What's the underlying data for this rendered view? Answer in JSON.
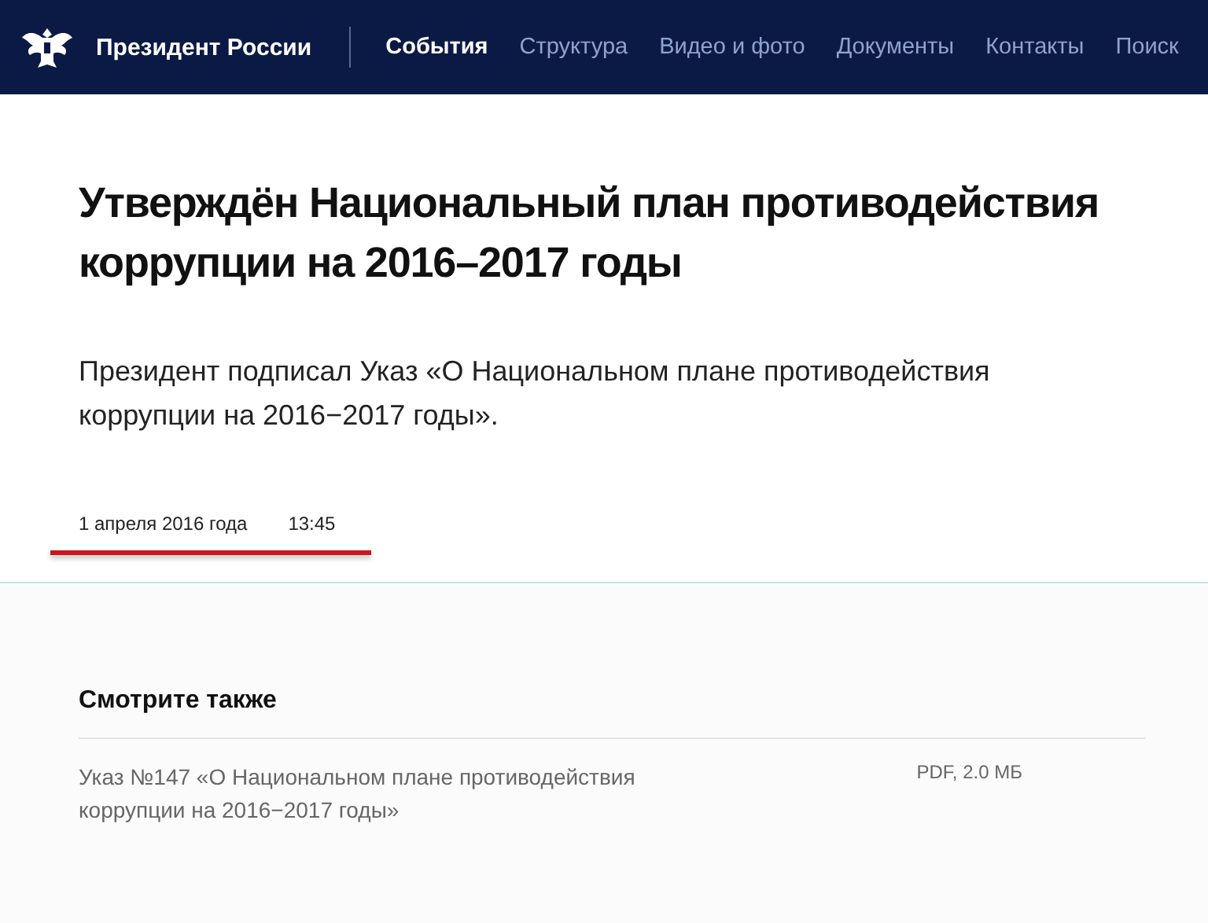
{
  "header": {
    "site_title": "Президент России",
    "nav": [
      {
        "label": "События",
        "selected": true
      },
      {
        "label": "Структура",
        "selected": false
      },
      {
        "label": "Видео и фото",
        "selected": false
      },
      {
        "label": "Документы",
        "selected": false
      },
      {
        "label": "Контакты",
        "selected": false
      },
      {
        "label": "Поиск",
        "selected": false
      }
    ]
  },
  "article": {
    "title": "Утверждён Национальный план противодействия коррупции на 2016–2017 годы",
    "lead": "Президент подписал Указ «О Национальном плане противодействия коррупции на 2016−2017 годы».",
    "date": "1 апреля 2016 года",
    "time": "13:45"
  },
  "see_also": {
    "heading": "Смотрите также",
    "items": [
      {
        "title": "Указ №147 «О Национальном плане противодействия коррупции на 2016−2017 годы»",
        "file": "PDF, 2.0 МБ"
      }
    ]
  }
}
